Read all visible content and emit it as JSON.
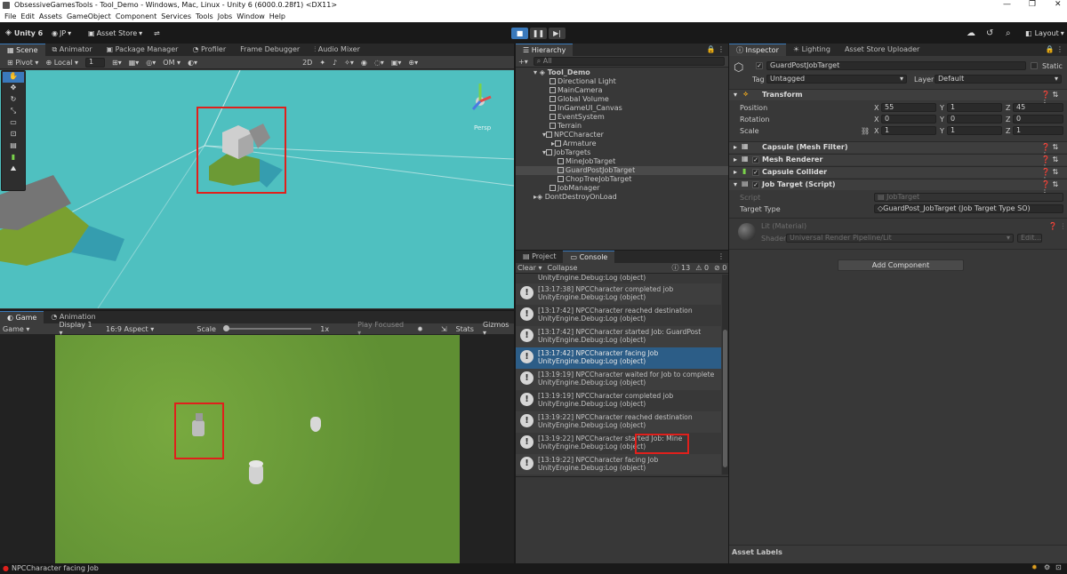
{
  "window": {
    "title": "ObsessiveGamesTools - Tool_Demo - Windows, Mac, Linux - Unity 6 (6000.0.28f1) <DX11>"
  },
  "menu": [
    "File",
    "Edit",
    "Assets",
    "GameObject",
    "Component",
    "Services",
    "Tools",
    "Jobs",
    "Window",
    "Help"
  ],
  "toolbar": {
    "unity": "Unity 6",
    "account": "JP",
    "asset_store": "Asset Store",
    "layout": "Layout"
  },
  "scene_tabs": [
    "Scene",
    "Animator",
    "Package Manager",
    "Profiler",
    "Frame Debugger",
    "Audio Mixer"
  ],
  "scene_toolbar": {
    "pivot": "Pivot",
    "space": "Local",
    "grid": "1",
    "draw": "OM"
  },
  "scene_gizmo": "Persp",
  "game_tabs": [
    "Game",
    "Animation"
  ],
  "game_toolbar": {
    "mode": "Game",
    "display": "Display 1",
    "aspect": "16:9 Aspect",
    "scale_label": "Scale",
    "scale_value": "1x",
    "play_focused": "Play Focused",
    "stats": "Stats",
    "gizmos": "Gizmos"
  },
  "hierarchy": {
    "tab": "Hierarchy",
    "search_placeholder": "All",
    "items": [
      {
        "label": "Tool_Demo",
        "depth": 0
      },
      {
        "label": "Directional Light",
        "depth": 2
      },
      {
        "label": "MainCamera",
        "depth": 2
      },
      {
        "label": "Global Volume",
        "depth": 2
      },
      {
        "label": "InGameUI_Canvas",
        "depth": 2
      },
      {
        "label": "EventSystem",
        "depth": 2
      },
      {
        "label": "Terrain",
        "depth": 2
      },
      {
        "label": "NPCCharacter",
        "depth": 2
      },
      {
        "label": "Armature",
        "depth": 3
      },
      {
        "label": "JobTargets",
        "depth": 2
      },
      {
        "label": "MineJobTarget",
        "depth": 3
      },
      {
        "label": "GuardPostJobTarget",
        "depth": 3
      },
      {
        "label": "ChopTreeJobTarget",
        "depth": 3
      },
      {
        "label": "JobManager",
        "depth": 2
      },
      {
        "label": "DontDestroyOnLoad",
        "depth": 1
      }
    ]
  },
  "console": {
    "tabs": [
      "Project",
      "Console"
    ],
    "clear": "Clear",
    "collapse": "Collapse",
    "counts": [
      "13",
      "0",
      "0"
    ],
    "top_partial": "UnityEngine.Debug:Log (object)",
    "entries": [
      {
        "line1": "[13:17:38] NPCCharacter completed job",
        "line2": "UnityEngine.Debug:Log (object)"
      },
      {
        "line1": "[13:17:42] NPCCharacter reached destination",
        "line2": "UnityEngine.Debug:Log (object)"
      },
      {
        "line1": "[13:17:42] NPCCharacter started Job: GuardPost",
        "line2": "UnityEngine.Debug:Log (object)"
      },
      {
        "line1": "[13:17:42] NPCCharacter facing Job",
        "line2": "UnityEngine.Debug:Log (object)"
      },
      {
        "line1": "[13:19:19] NPCCharacter waited for Job to complete",
        "line2": "UnityEngine.Debug:Log (object)"
      },
      {
        "line1": "[13:19:19] NPCCharacter completed job",
        "line2": "UnityEngine.Debug:Log (object)"
      },
      {
        "line1": "[13:19:22] NPCCharacter reached destination",
        "line2": "UnityEngine.Debug:Log (object)"
      },
      {
        "line1": "[13:19:22] NPCCharacter started Job: Mine",
        "line2": "UnityEngine.Debug:Log (object)"
      },
      {
        "line1": "[13:19:22] NPCCharacter facing Job",
        "line2": "UnityEngine.Debug:Log (object)"
      }
    ]
  },
  "inspector": {
    "tabs": [
      "Inspector",
      "Lighting",
      "Asset Store Uploader"
    ],
    "object_name": "GuardPostJobTarget",
    "static": "Static",
    "tag_label": "Tag",
    "tag": "Untagged",
    "layer_label": "Layer",
    "layer": "Default",
    "transform": {
      "title": "Transform",
      "position_label": "Position",
      "rotation_label": "Rotation",
      "scale_label": "Scale",
      "position": [
        "55",
        "1",
        "45"
      ],
      "rotation": [
        "0",
        "0",
        "0"
      ],
      "scale": [
        "1",
        "1",
        "1"
      ]
    },
    "components": [
      "Capsule (Mesh Filter)",
      "Mesh Renderer",
      "Capsule Collider",
      "Job Target (Script)"
    ],
    "script_label": "Script",
    "script_value": "JobTarget",
    "target_type_label": "Target Type",
    "target_type_value": "GuardPost_JobTarget (Job Target Type SO)",
    "material": "Lit (Material)",
    "shader_label": "Shader",
    "shader_value": "Universal Render Pipeline/Lit",
    "edit": "Edit...",
    "add_component": "Add Component",
    "asset_labels": "Asset Labels"
  },
  "status": {
    "message": "NPCCharacter facing Job"
  },
  "colors": {
    "accent": "#3a79bb",
    "highlight": "#e0201c",
    "scene_water": "#4fc0c0",
    "grass": "#6c9c38"
  }
}
